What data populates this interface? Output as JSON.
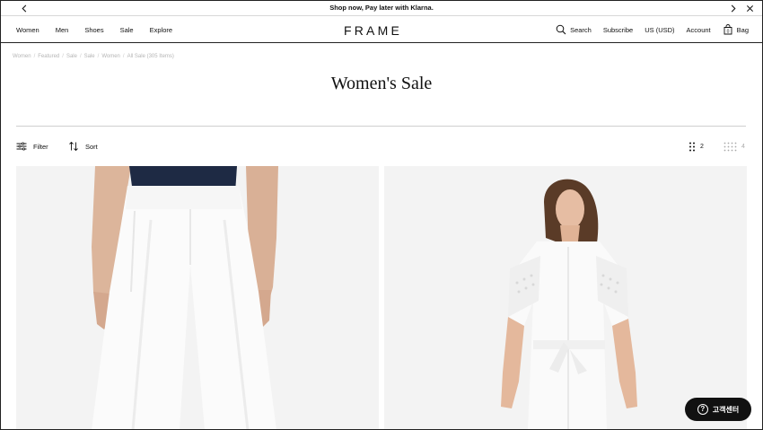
{
  "promo": {
    "text": "Shop now, Pay later with Klarna."
  },
  "header": {
    "nav_left": [
      "Women",
      "Men",
      "Shoes",
      "Sale",
      "Explore"
    ],
    "logo": "FRAME",
    "search_label": "Search",
    "subscribe_label": "Subscribe",
    "currency_label": "US (USD)",
    "account_label": "Account",
    "bag_label": "Bag",
    "bag_count": "0"
  },
  "breadcrumb": [
    "Women",
    "Featured",
    "Sale",
    "Sale",
    "Women",
    "All Sale (305 Items)"
  ],
  "page": {
    "title": "Women's Sale"
  },
  "toolbar": {
    "filter_label": "Filter",
    "sort_label": "Sort",
    "grid_two_label": "2",
    "grid_four_label": "4"
  },
  "chat": {
    "label": "고객센터",
    "icon_glyph": "?"
  },
  "colors": {
    "accent": "#111111",
    "breadcrumb": "#b5b5b5",
    "product_bg": "#f2f2f2"
  }
}
